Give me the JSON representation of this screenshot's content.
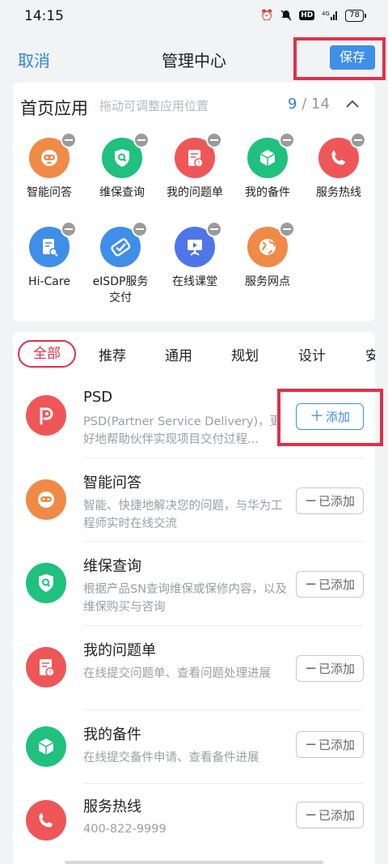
{
  "status_bar": {
    "time": "14:15",
    "battery": "78",
    "network": "4G",
    "hd": "HD"
  },
  "nav": {
    "cancel": "取消",
    "title": "管理中心",
    "save": "保存"
  },
  "home_apps": {
    "title": "首页应用",
    "hint": "拖动可调整应用位置",
    "count_current": "9",
    "count_separator": "/",
    "count_total": "14",
    "items": [
      {
        "label": "智能问答",
        "icon": "robot-icon",
        "color": "#f08a47"
      },
      {
        "label": "维保查询",
        "icon": "shield-search-icon",
        "color": "#20c07f"
      },
      {
        "label": "我的问题单",
        "icon": "question-doc-icon",
        "color": "#ef5658"
      },
      {
        "label": "我的备件",
        "icon": "cube-icon",
        "color": "#20c07f"
      },
      {
        "label": "服务热线",
        "icon": "phone-icon",
        "color": "#ef5658"
      },
      {
        "label": "Hi-Care",
        "icon": "doc-wrench-icon",
        "color": "#3f8ee8"
      },
      {
        "label": "eISDP服务交付",
        "icon": "check-card-icon",
        "color": "#3f8ee8"
      },
      {
        "label": "在线课堂",
        "icon": "presentation-icon",
        "color": "#4f76e8"
      },
      {
        "label": "服务网点",
        "icon": "globe-icon",
        "color": "#f08a47"
      }
    ]
  },
  "tabs": [
    "全部",
    "推荐",
    "通用",
    "规划",
    "设计",
    "安"
  ],
  "app_list": [
    {
      "name": "PSD",
      "desc": "PSD(Partner Service Delivery)，更好地帮助伙伴实现项目交付过程...",
      "action": "添加",
      "added": false,
      "icon": "psd-icon",
      "color": "#ef5658"
    },
    {
      "name": "智能问答",
      "desc": "智能、快捷地解决您的问题，与华为工程师实时在线交流",
      "action": "已添加",
      "added": true,
      "icon": "robot-icon",
      "color": "#f08a47"
    },
    {
      "name": "维保查询",
      "desc": "根据产品SN查询维保或保修内容，以及维保购买与咨询",
      "action": "已添加",
      "added": true,
      "icon": "shield-search-icon",
      "color": "#20c07f"
    },
    {
      "name": "我的问题单",
      "desc": "在线提交问题单、查看问题处理进展",
      "action": "已添加",
      "added": true,
      "icon": "question-doc-icon",
      "color": "#ef5658"
    },
    {
      "name": "我的备件",
      "desc": "在线提交备件申请、查看备件进展",
      "action": "已添加",
      "added": true,
      "icon": "cube-icon",
      "color": "#20c07f"
    },
    {
      "name": "服务热线",
      "desc": "400-822-9999",
      "action": "已添加",
      "added": true,
      "icon": "phone-icon",
      "color": "#ef5658"
    }
  ]
}
